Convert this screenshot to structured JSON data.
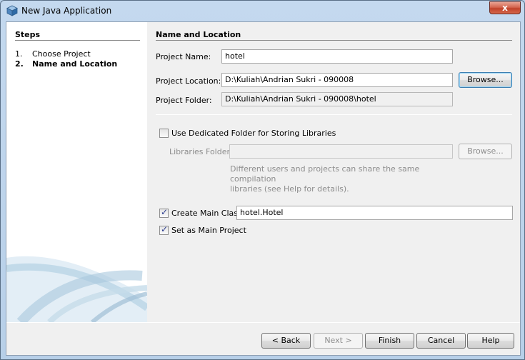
{
  "window": {
    "title": "New Java Application",
    "close_glyph": "x"
  },
  "steps": {
    "title": "Steps",
    "items": [
      {
        "num": "1.",
        "label": "Choose Project"
      },
      {
        "num": "2.",
        "label": "Name and Location"
      }
    ]
  },
  "section": {
    "title": "Name and Location"
  },
  "form": {
    "project_name_label": "Project Name:",
    "project_name_value": "hotel",
    "project_location_label": "Project Location:",
    "project_location_value": "D:\\Kuliah\\Andrian Sukri - 090008",
    "browse_label": "Browse...",
    "project_folder_label": "Project Folder:",
    "project_folder_value": "D:\\Kuliah\\Andrian Sukri - 090008\\hotel",
    "dedicated_folder_label": "Use Dedicated Folder for Storing Libraries",
    "dedicated_folder_checked": false,
    "libraries_folder_label": "Libraries Folder:",
    "libraries_folder_value": "",
    "libraries_browse_label": "Browse...",
    "libraries_help_line1": "Different users and projects can share the same compilation",
    "libraries_help_line2": "libraries (see Help for details).",
    "create_main_class_label": "Create Main Class",
    "create_main_class_checked": true,
    "main_class_value": "hotel.Hotel",
    "set_main_project_label": "Set as Main Project",
    "set_main_project_checked": true,
    "check_glyph": "✓"
  },
  "footer": {
    "back_label": "< Back",
    "next_label": "Next >",
    "finish_label": "Finish",
    "cancel_label": "Cancel",
    "help_label": "Help"
  }
}
